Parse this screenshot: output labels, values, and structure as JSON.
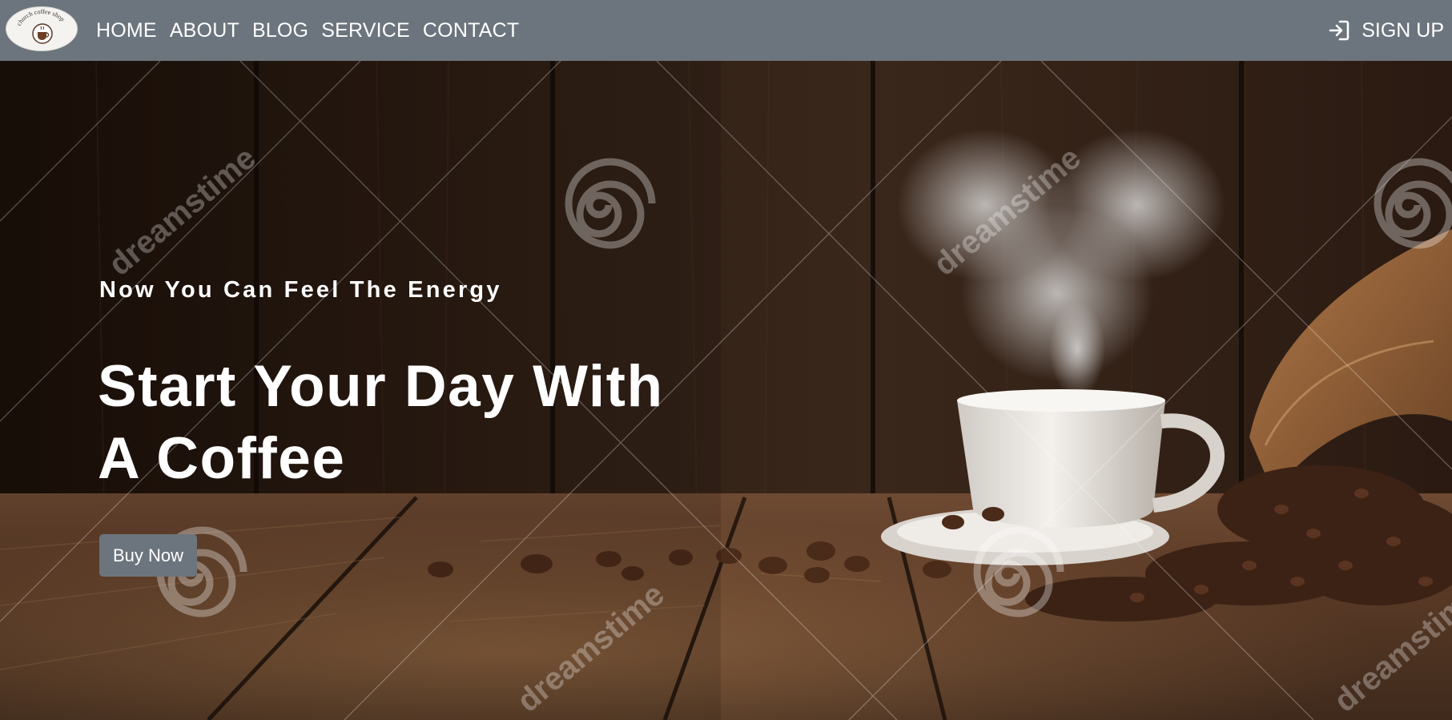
{
  "brand": {
    "logo_text": "church coffee shop",
    "logo_icon": "coffee-cup-icon"
  },
  "nav": {
    "links": [
      "HOME",
      "ABOUT",
      "BLOG",
      "SERVICE",
      "CONTACT"
    ],
    "signup_label": "SIGN UP",
    "signup_icon": "sign-in-icon"
  },
  "hero": {
    "tagline": "Now You Can Feel The Energy",
    "headline_line1": "Start Your Day With",
    "headline_line2": "A Coffee",
    "button_label": "Buy Now",
    "watermark": "dreamstime",
    "image_subject": "steaming coffee cup on rustic wooden table with coffee beans and burlap sack"
  },
  "colors": {
    "navbar_bg": "#6c757d",
    "button_bg": "#6c757d",
    "text": "#ffffff",
    "wood_dark": "#2b1b12",
    "wood_light": "#7a5236"
  }
}
